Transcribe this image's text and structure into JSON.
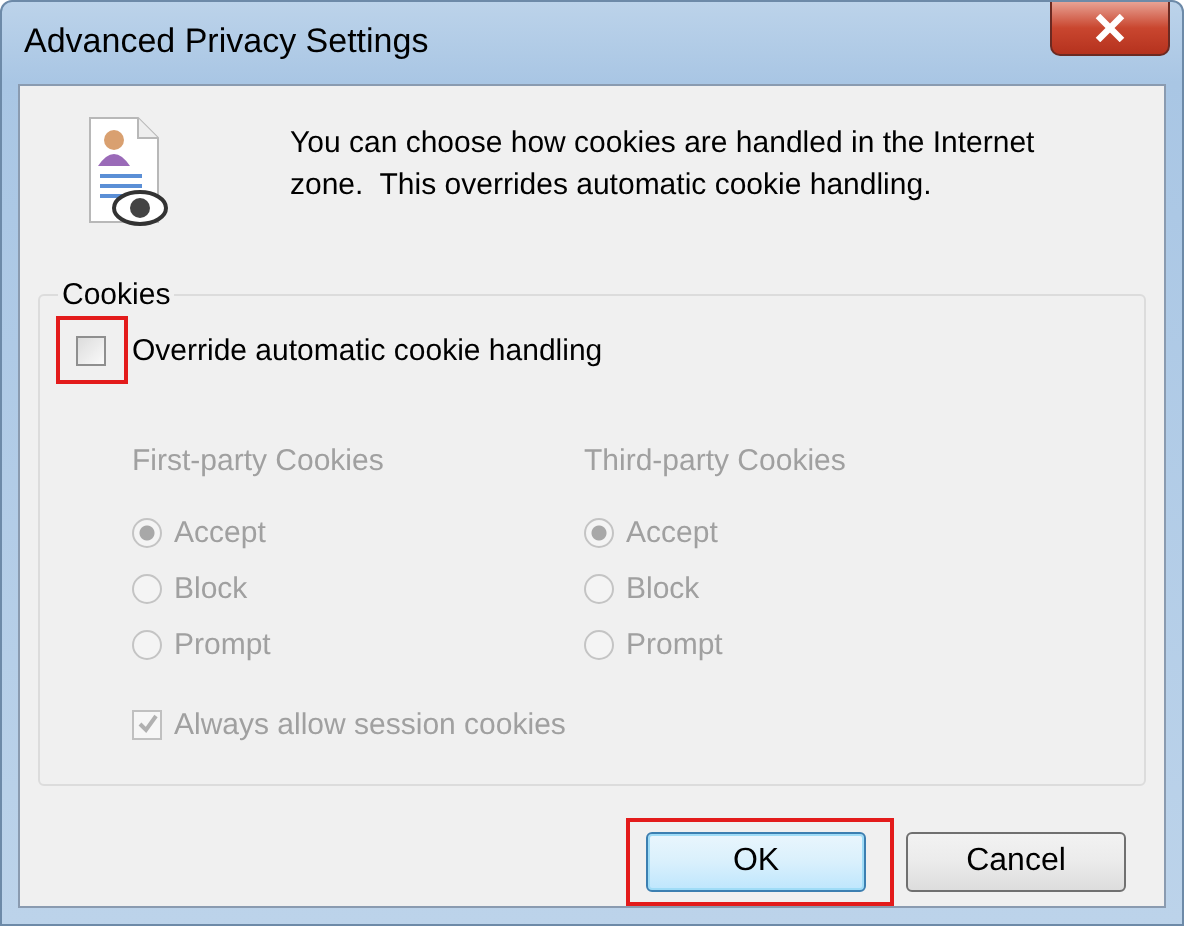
{
  "window": {
    "title": "Advanced Privacy Settings"
  },
  "description": "You can choose how cookies are handled in the Internet zone.  This overrides automatic cookie handling.",
  "cookies": {
    "legend": "Cookies",
    "override": {
      "label": "Override automatic cookie handling",
      "checked": false,
      "highlighted": true
    },
    "disabled": true,
    "columns": [
      {
        "heading": "First-party Cookies",
        "options": [
          {
            "label": "Accept",
            "selected": true
          },
          {
            "label": "Block",
            "selected": false
          },
          {
            "label": "Prompt",
            "selected": false
          }
        ]
      },
      {
        "heading": "Third-party Cookies",
        "options": [
          {
            "label": "Accept",
            "selected": true
          },
          {
            "label": "Block",
            "selected": false
          },
          {
            "label": "Prompt",
            "selected": false
          }
        ]
      }
    ],
    "session": {
      "label": "Always allow session cookies",
      "checked": true
    }
  },
  "buttons": [
    {
      "label": "OK",
      "default": true,
      "highlighted": true
    },
    {
      "label": "Cancel",
      "default": false,
      "highlighted": false
    }
  ]
}
